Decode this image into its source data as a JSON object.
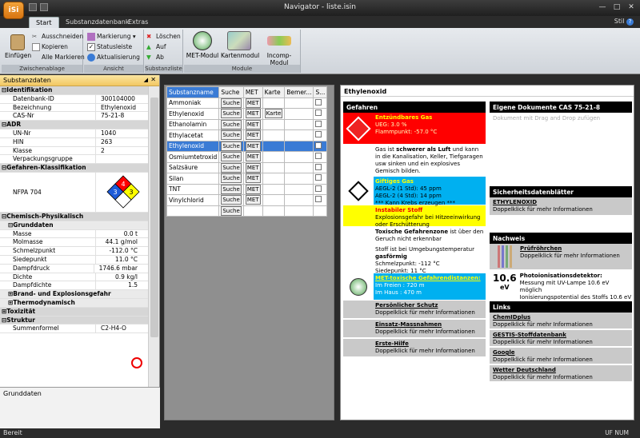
{
  "app": {
    "logo": "iSi",
    "title": "Navigator - liste.isin"
  },
  "tabs": [
    "Start",
    "Substanzdatenbank",
    "Extras"
  ],
  "stil": "Stil",
  "ribbon": {
    "einfuegen": "Einfügen",
    "ausschneiden": "Ausschneiden",
    "kopieren": "Kopieren",
    "alle_markieren": "Alle Markieren",
    "group_zwischenablage": "Zwischenablage",
    "markierung": "Markierung",
    "statusleiste": "Statusleiste",
    "aktualisierung": "Aktualisierung",
    "group_ansicht": "Ansicht",
    "loeschen": "Löschen",
    "auf": "Auf",
    "ab": "Ab",
    "group_substanzliste": "Substanzliste",
    "met_modul": "MET-Modul",
    "kartenmodul": "Kartenmodul",
    "incomp_modul": "Incomp-Modul",
    "group_module": "Module"
  },
  "left": {
    "title": "Substanzdaten",
    "identifikation": "Identifikation",
    "rows_id": [
      {
        "k": "Datenbank-ID",
        "v": "300104000"
      },
      {
        "k": "Bezeichnung",
        "v": "Ethylenoxid"
      },
      {
        "k": "CAS-Nr",
        "v": "75-21-8"
      }
    ],
    "adr": "ADR",
    "rows_adr": [
      {
        "k": "UN-Nr",
        "v": "1040"
      },
      {
        "k": "HIN",
        "v": "263"
      },
      {
        "k": "Klasse",
        "v": "2"
      },
      {
        "k": "Verpackungsgruppe",
        "v": ""
      }
    ],
    "gefahren": "Gefahren-Klassifikation",
    "nfpa": "NFPA 704",
    "nfpa_values": {
      "health": "3",
      "flammability": "4",
      "reactivity": "3"
    },
    "chem": "Chemisch-Physikalisch",
    "grunddaten": "Grunddaten",
    "rows_grund": [
      {
        "k": "Masse",
        "v": "0.0 t"
      },
      {
        "k": "Molmasse",
        "v": "44.1 g/mol"
      },
      {
        "k": "Schmelzpunkt",
        "v": "-112.0 °C"
      },
      {
        "k": "Siedepunkt",
        "v": "11.0 °C"
      },
      {
        "k": "Dampfdruck",
        "v": "1746.6 mbar"
      },
      {
        "k": "Dichte",
        "v": "0.9 kg/l"
      },
      {
        "k": "Dampfdichte",
        "v": "1.5"
      }
    ],
    "brand": "Brand- und Explosionsgefahr",
    "thermo": "Thermodynamisch",
    "toxizitaet": "Toxizität",
    "struktur": "Struktur",
    "summenformel_k": "Summenformel",
    "summenformel_v": "C2-H4-O",
    "bottom": "Grunddaten"
  },
  "table": {
    "headers": [
      "Substanzname",
      "Suche",
      "MET",
      "Karte",
      "Bemer...",
      "S..."
    ],
    "suche": "Suche",
    "met": "MET",
    "karte": "Karte",
    "rows": [
      {
        "name": "Ammoniak",
        "met": true,
        "karte": false
      },
      {
        "name": "Ethylenoxid",
        "met": true,
        "karte": true
      },
      {
        "name": "Ethanolamin",
        "met": true,
        "karte": false
      },
      {
        "name": "Ethylacetat",
        "met": true,
        "karte": false
      },
      {
        "name": "Ethylenoxid",
        "met": true,
        "karte": false,
        "selected": true
      },
      {
        "name": "Osmiumtetroxid",
        "met": true,
        "karte": false
      },
      {
        "name": "Salzsäure",
        "met": true,
        "karte": false
      },
      {
        "name": "Silan",
        "met": true,
        "karte": false
      },
      {
        "name": "TNT",
        "met": true,
        "karte": false
      },
      {
        "name": "Vinylchlorid",
        "met": true,
        "karte": false
      },
      {
        "name": "",
        "met": false,
        "karte": false
      }
    ]
  },
  "detail": {
    "title": "Ethylenoxid",
    "gefahren": "Gefahren",
    "entz_title": "Entzündbares Gas",
    "entz_1": "UEG: 3.0 %",
    "entz_2": "Flammpunkt: -57.0 °C",
    "luft_pre": "Gas ist ",
    "luft_bold": "schwerer als Luft",
    "luft_rest": "und kann in die Kanalisation, Keller, Tiefgaragen usw sinken und ein explosives Gemisch bilden.",
    "gift_title": "Giftiges Gas",
    "gift_1": "AEGL-2 (1 Std): 45 ppm",
    "gift_2": "AEGL-2 (4 Std): 14 ppm",
    "gift_3": "*** Kann Krebs erzeugen ***",
    "instabil_title": "Instabiler Stoff",
    "instabil_text": "Explosionsgefahr bei Hitzeeinwirkung oder Erschütterung",
    "toxzone": "Toxische Gefahrenzone",
    "toxzone_rest": " ist über den Geruch nicht erkennbar",
    "gasf_1": "Stoff ist bei Umgebungstemperatur",
    "gasf_bold": "gasförmig",
    "gasf_2": "Schmelzpunkt: -112 °C",
    "gasf_3": "Siedepunkt: 11 °C",
    "met_title": "MET-toxische Gefahrendistanzen:",
    "met_1": "Im Freien : 720 m",
    "met_2": "Im Haus : 470 m",
    "ps_title": "Persönlicher Schutz",
    "ps_text": "Doppelklick für mehr Informationen",
    "em_title": "Einsatz-Massnahmen",
    "em_text": "Doppelklick für mehr Informationen",
    "eh_title": "Erste-Hilfe",
    "eh_text": "Doppelklick für mehr Informationen",
    "eig_head": "Eigene Dokumente CAS 75-21-8",
    "eig_text": "Dokument mit Drag and Drop zufügen",
    "sdb_head": "Sicherheitsdatenblätter",
    "sdb_title": "ETHYLENOXID",
    "sdb_text": "Doppelklick für mehr Informationen",
    "nachweis_head": "Nachweis",
    "pr_title": "Prüfröhrchen",
    "pr_text": "Doppelklick für mehr Informationen",
    "pid_value": "10.6",
    "pid_unit": "eV",
    "pid_title": "Photoionisationsdetektor:",
    "pid_text1": "Messung mit UV-Lampe 10.6 eV möglich",
    "pid_text2": "Ionisierungspotential des Stoffs 10.6 eV",
    "links_head": "Links",
    "links": [
      {
        "title": "ChemIDplus",
        "text": "Doppelklick für mehr Informationen"
      },
      {
        "title": "GESTIS-Stoffdatenbank",
        "text": "Doppelklick für mehr Informationen"
      },
      {
        "title": "Google",
        "text": "Doppelklick für mehr Informationen"
      },
      {
        "title": "Wetter Deutschland",
        "text": "Doppelklick für mehr Informationen"
      }
    ]
  },
  "status": {
    "left": "Bereit",
    "uf": "UF",
    "num": "NUM"
  },
  "colors": {
    "red": "#ff0000",
    "cyan": "#00b0f0",
    "yellow": "#ffff00",
    "ribbon": "#e7eaee"
  }
}
